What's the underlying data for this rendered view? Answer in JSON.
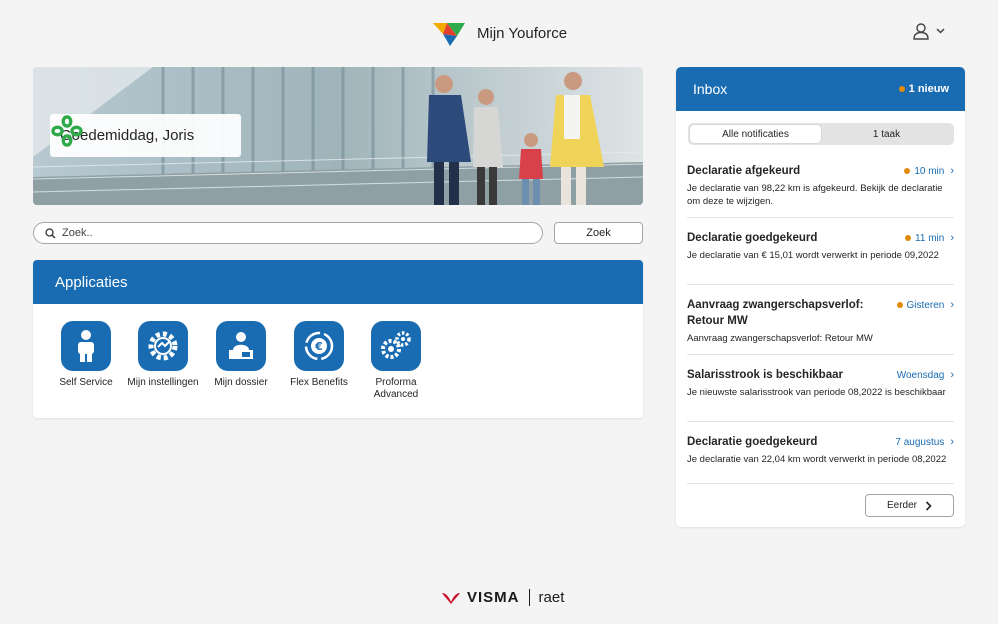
{
  "header": {
    "title": "Mijn Youforce",
    "user_icon": "user-icon",
    "menu_icon": "chevron-down-icon"
  },
  "hero": {
    "greeting": "Goedemiddag, Joris"
  },
  "search": {
    "placeholder": "Zoek..",
    "button_label": "Zoek"
  },
  "applications": {
    "title": "Applicaties",
    "items": [
      {
        "label": "Self Service",
        "icon": "person-icon"
      },
      {
        "label": "Mijn instellingen",
        "icon": "settings-gear-icon"
      },
      {
        "label": "Mijn dossier",
        "icon": "dossier-icon"
      },
      {
        "label": "Flex Benefits",
        "icon": "euro-exchange-icon"
      },
      {
        "label": "Proforma Advanced",
        "icon": "gears-icon"
      }
    ]
  },
  "inbox": {
    "title": "Inbox",
    "new_label": "1 nieuw",
    "tabs": [
      {
        "label": "Alle notificaties",
        "active": true
      },
      {
        "label": "1 taak",
        "active": false
      }
    ],
    "notifications": [
      {
        "title": "Declaratie afgekeurd",
        "time": "10 min",
        "unread": true,
        "body": "Je declaratie van 98,22 km is afgekeurd. Bekijk de declaratie om deze te wijzigen."
      },
      {
        "title": "Declaratie goedgekeurd",
        "time": "11 min",
        "unread": true,
        "body": "Je declaratie van € 15,01 wordt verwerkt in periode 09,2022"
      },
      {
        "title": "Aanvraag zwangerschapsverlof: Retour MW",
        "time": "Gisteren",
        "unread": true,
        "body": "Aanvraag zwangerschapsverlof: Retour MW"
      },
      {
        "title": "Salarisstrook is beschikbaar",
        "time": "Woensdag",
        "unread": false,
        "body": "Je nieuwste salarisstrook van periode 08,2022 is beschikbaar"
      },
      {
        "title": "Declaratie goedgekeurd",
        "time": "7 augustus",
        "unread": false,
        "body": "Je declaratie van 22,04 km wordt verwerkt in periode 08,2022"
      }
    ],
    "earlier_label": "Eerder"
  },
  "footer": {
    "brand1": "VISMA",
    "brand2": "raet"
  },
  "colors": {
    "primary": "#1a6cb2",
    "unread_dot": "#e18b0a",
    "background": "#f4f4f4"
  }
}
